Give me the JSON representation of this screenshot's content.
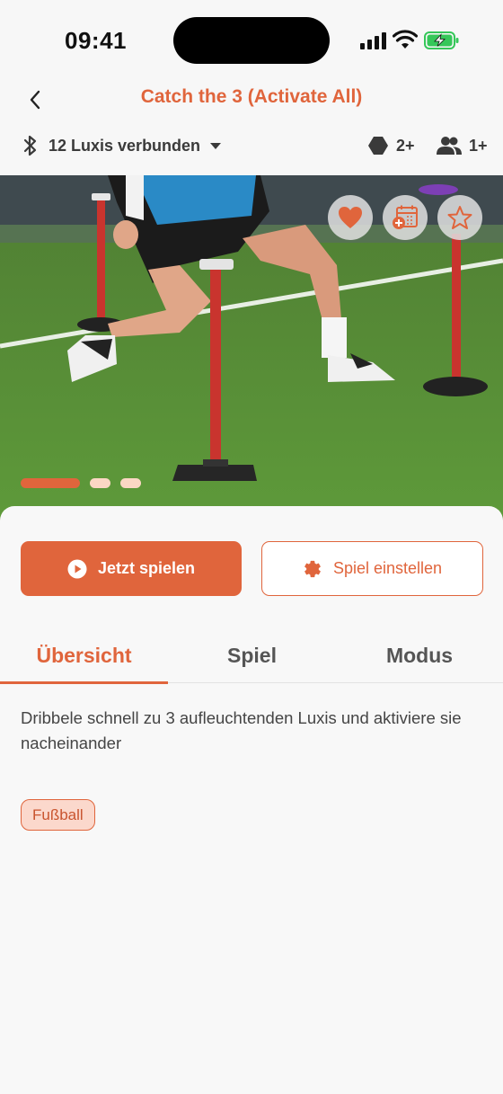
{
  "status_bar": {
    "time": "09:41"
  },
  "header": {
    "title": "Catch the 3 (Activate All)"
  },
  "info": {
    "connection_label": "12 Luxis verbunden",
    "level": "2+",
    "players": "1+"
  },
  "hero": {
    "slides_total": 3,
    "active_slide": 1
  },
  "actions": {
    "play_label": "Jetzt spielen",
    "settings_label": "Spiel einstellen"
  },
  "tabs": [
    {
      "label": "Übersicht",
      "active": true
    },
    {
      "label": "Spiel",
      "active": false
    },
    {
      "label": "Modus",
      "active": false
    }
  ],
  "overview": {
    "description": "Dribbele schnell zu 3 aufleuchtenden Luxis und aktiviere sie nacheinander",
    "tag": "Fußball"
  },
  "colors": {
    "accent": "#e0653c",
    "accent_light": "#fbd8cc",
    "text": "#3a3a3a",
    "background": "#f8f8f8"
  }
}
